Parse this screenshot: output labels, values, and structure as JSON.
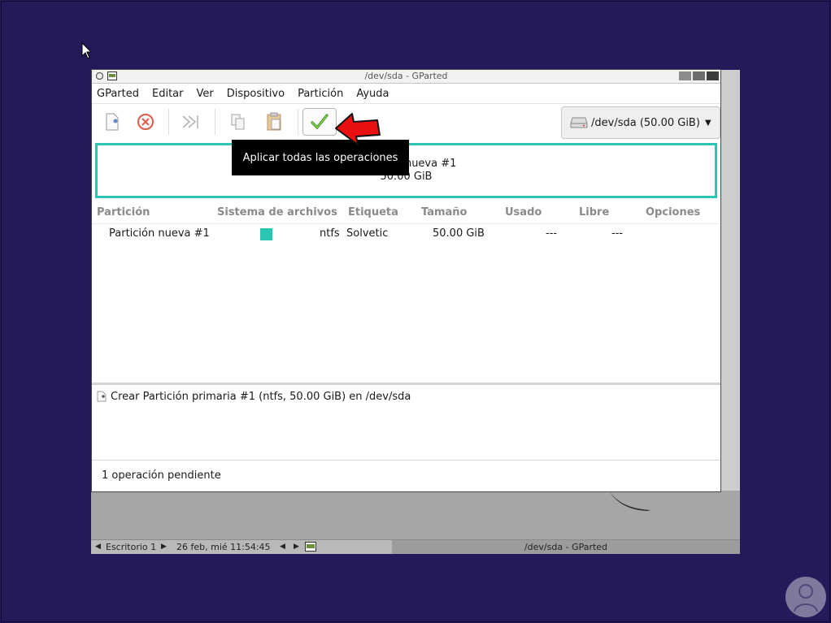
{
  "window": {
    "title": "/dev/sda - GParted"
  },
  "menu": {
    "items": [
      "GParted",
      "Editar",
      "Ver",
      "Dispositivo",
      "Partición",
      "Ayuda"
    ]
  },
  "toolbar": {
    "device_label": "/dev/sda (50.00 GiB)",
    "tooltip": "Aplicar todas las operaciones"
  },
  "graph": {
    "partition_name": "Partición nueva #1",
    "partition_size": "50.00 GiB",
    "color": "#2cc4b2"
  },
  "table": {
    "headers": [
      "Partición",
      "Sistema de archivos",
      "Etiqueta",
      "Tamaño",
      "Usado",
      "Libre",
      "Opciones"
    ],
    "rows": [
      {
        "partition": "Partición nueva #1",
        "filesystem": "ntfs",
        "label": "Solvetic",
        "size": "50.00 GiB",
        "used": "---",
        "free": "---",
        "options": ""
      }
    ]
  },
  "operations": {
    "items": [
      "Crear Partición primaria #1 (ntfs, 50.00 GiB) en /dev/sda"
    ]
  },
  "status": {
    "text": "1 operación pendiente"
  },
  "panel": {
    "workspace": "Escritorio 1",
    "datetime": "26 feb, mié 11:54:45",
    "task": "/dev/sda - GParted"
  },
  "colors": {
    "desktop_bg": "#25195a",
    "accent": "#2cc4b2",
    "arrow": "#e81010"
  }
}
